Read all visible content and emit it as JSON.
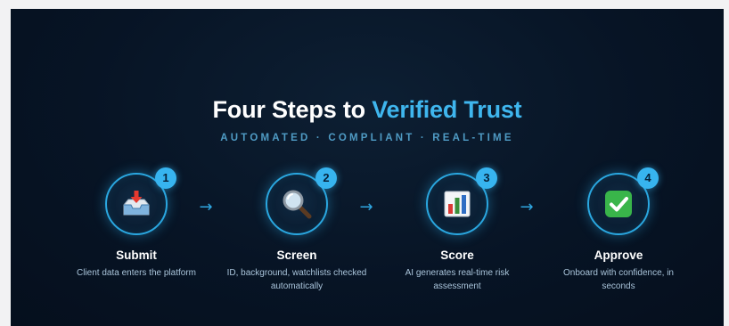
{
  "header": {
    "title_main": "Four Steps to ",
    "title_accent": "Verified Trust",
    "subtitle": "AUTOMATED · COMPLIANT · REAL-TIME"
  },
  "steps": [
    {
      "number": "1",
      "title": "Submit",
      "description": "Client data enters the platform",
      "icon": "inbox-tray-icon"
    },
    {
      "number": "2",
      "title": "Screen",
      "description": "ID, background, watchlists checked automatically",
      "icon": "magnifying-glass-icon"
    },
    {
      "number": "3",
      "title": "Score",
      "description": "AI generates real-time risk assessment",
      "icon": "bar-chart-icon"
    },
    {
      "number": "4",
      "title": "Approve",
      "description": "Onboard with confidence, in seconds",
      "icon": "check-mark-icon"
    }
  ],
  "arrow_glyph": "→",
  "colors": {
    "background": "#071425",
    "accent": "#3fb6ee",
    "ring": "#2aa7e0",
    "subtitle": "#4f9bc4"
  }
}
